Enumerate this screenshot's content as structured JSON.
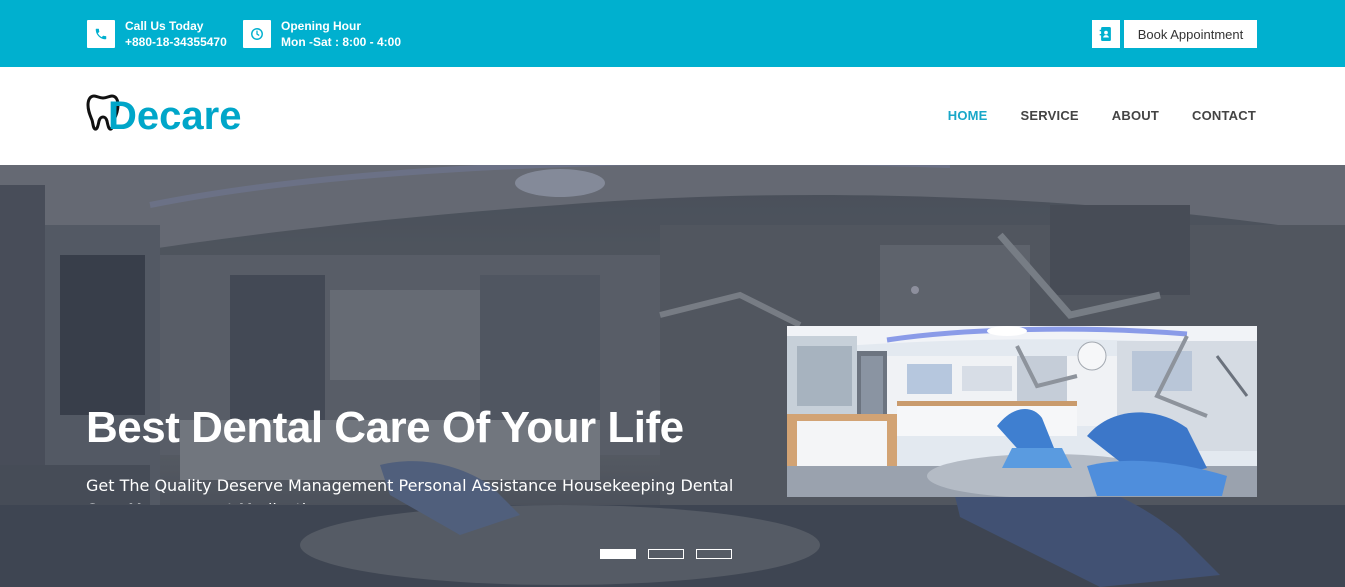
{
  "topbar": {
    "phone": {
      "icon": "phone-icon",
      "label": "Call Us Today",
      "value": "+880-18-34355470"
    },
    "hours": {
      "icon": "clock-icon",
      "label": "Opening Hour",
      "value": "Mon -Sat : 8:00 - 4:00"
    },
    "book": {
      "icon": "contact-book-icon",
      "label": "Book Appointment"
    }
  },
  "header": {
    "logo_icon": "tooth-icon",
    "logo_text": "Decare",
    "nav": [
      {
        "label": "HOME",
        "active": true
      },
      {
        "label": "SERVICE",
        "active": false
      },
      {
        "label": "ABOUT",
        "active": false
      },
      {
        "label": "CONTACT",
        "active": false
      }
    ]
  },
  "hero": {
    "title": "Best Dental Care Of Your Life",
    "subtitle": "Get The Quality Deserve Management Personal Assistance Housekeeping Dental Care Management Medication",
    "slides": 3,
    "active_slide": 0
  },
  "colors": {
    "brand": "#00b0cf",
    "logo": "#00a6c9",
    "nav_active": "#19a7c8",
    "nav_text": "#444444"
  }
}
